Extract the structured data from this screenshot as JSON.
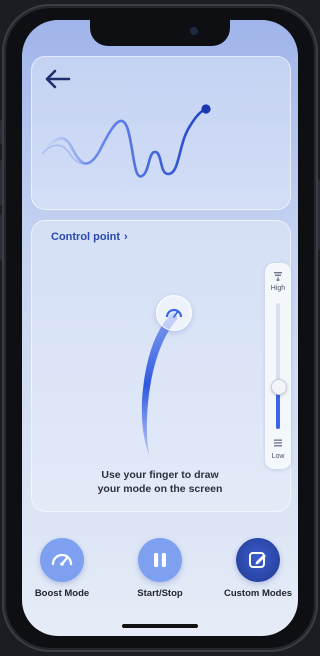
{
  "header": {
    "back_icon": "arrow-left-icon"
  },
  "control_point": {
    "label": "Control point",
    "chevron": "›"
  },
  "intensity_slider": {
    "high_label": "High",
    "low_label": "Low",
    "level": 0.34
  },
  "instruction": {
    "line1": "Use your finger to draw",
    "line2": "your mode on the screen"
  },
  "actions": [
    {
      "label": "Boost Mode",
      "icon": "speedometer-icon"
    },
    {
      "label": "Start/Stop",
      "icon": "pause-icon"
    },
    {
      "label": "Custom Modes",
      "icon": "edit-icon"
    }
  ],
  "colors": {
    "accent": "#3c66e8",
    "accent_dark": "#2b47a8",
    "button_light": "#7ea0f0",
    "link": "#2a49a8"
  }
}
